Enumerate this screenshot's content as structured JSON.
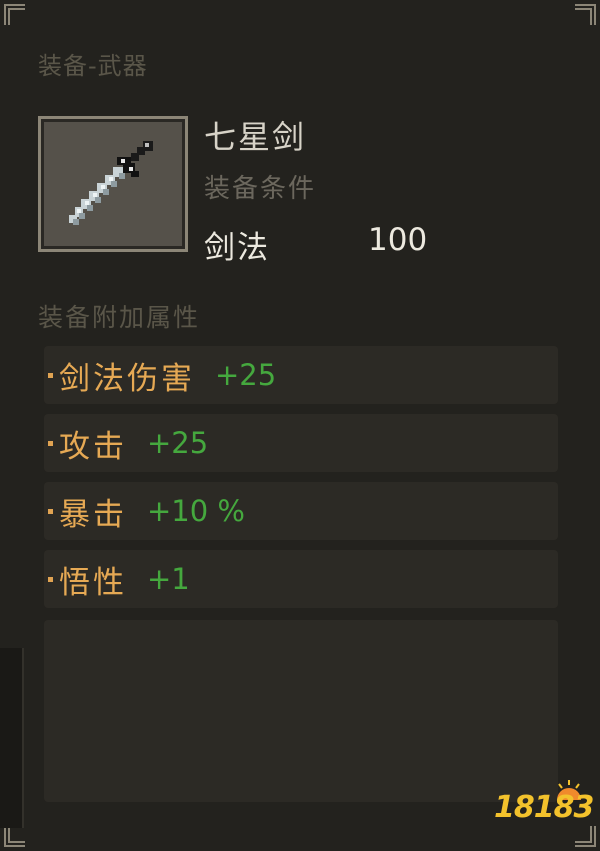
{
  "panel": {
    "category": "装备-武器",
    "item_name": "七星剑",
    "icon": "sword-icon",
    "requirement": {
      "title": "装备条件",
      "skill": "剑法",
      "value": "100"
    },
    "attributes_title": "装备附加属性",
    "attributes": [
      {
        "name": "剑法伤害",
        "value": "+25"
      },
      {
        "name": "攻击",
        "value": "+25"
      },
      {
        "name": "暴击",
        "value": "+10 %"
      },
      {
        "name": "悟性",
        "value": "+1"
      }
    ]
  },
  "colors": {
    "panel_bg": "#23221e",
    "row_bg": "#2c2a25",
    "attr_name": "#e6a954",
    "attr_value": "#45a83e",
    "title_text": "#d7d3c8",
    "dim_text": "#5a5649"
  },
  "watermark": {
    "text": "18183"
  }
}
